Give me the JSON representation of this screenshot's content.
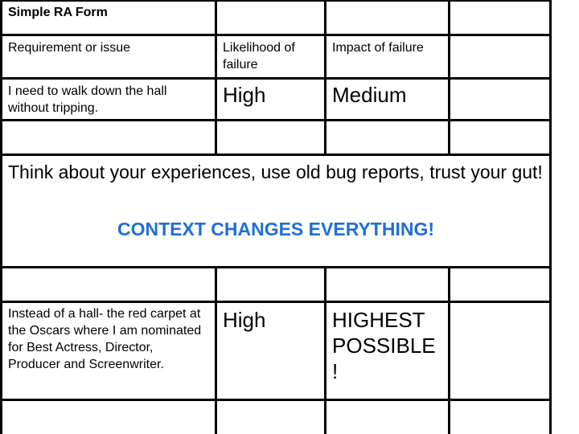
{
  "form": {
    "title": "Simple RA Form",
    "headers": {
      "requirement": "Requirement or issue",
      "likelihood": "Likelihood of failure",
      "impact": "Impact of failure"
    },
    "rows": [
      {
        "requirement": "I need to walk down the hall without tripping.",
        "likelihood": "High",
        "impact": "Medium"
      },
      {
        "requirement": "Instead of a hall- the red carpet at the Oscars where I am nominated for Best Actress, Director, Producer and Screenwriter.",
        "likelihood": "High",
        "impact": "HIGHEST POSSIBLE !"
      }
    ],
    "note": "Think about your experiences, use old bug reports, trust your gut!",
    "emphasis": "CONTEXT CHANGES EVERYTHING!",
    "colors": {
      "accent": "#1f6fd8",
      "border": "#000000"
    }
  }
}
